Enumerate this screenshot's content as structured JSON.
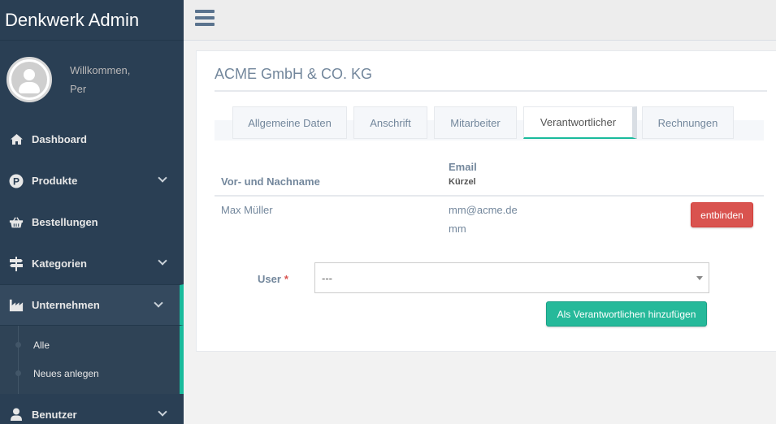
{
  "brand": {
    "title": "Denkwerk Admin"
  },
  "profile": {
    "welcome": "Willkommen,",
    "name": "Per"
  },
  "sidebar": {
    "items": [
      {
        "label": "Dashboard",
        "icon": "home-icon"
      },
      {
        "label": "Produkte",
        "icon": "parking-icon"
      },
      {
        "label": "Bestellungen",
        "icon": "basket-icon"
      },
      {
        "label": "Kategorien",
        "icon": "signpost-icon"
      },
      {
        "label": "Unternehmen",
        "icon": "industry-icon"
      },
      {
        "label": "Benutzer",
        "icon": "user-icon"
      }
    ],
    "submenu": [
      {
        "label": "Alle"
      },
      {
        "label": "Neues anlegen"
      }
    ]
  },
  "panel": {
    "title": "ACME GmbH & CO. KG"
  },
  "tabs": [
    {
      "label": "Allgemeine Daten"
    },
    {
      "label": "Anschrift"
    },
    {
      "label": "Mitarbeiter"
    },
    {
      "label": "Verantwortlicher"
    },
    {
      "label": "Rechnungen"
    }
  ],
  "table": {
    "headers": {
      "name": "Vor- und Nachname",
      "email": "Email",
      "kuerzel": "Kürzel"
    },
    "rows": [
      {
        "name": "Max Müller",
        "email": "mm@acme.de",
        "kuerzel": "mm",
        "action": "entbinden"
      }
    ]
  },
  "form": {
    "user_label": "User",
    "required_mark": "*",
    "select_value": "---",
    "submit_label": "Als Verantwortlichen hinzufügen"
  },
  "colors": {
    "accent": "#1abb9c",
    "sidebar": "#2a3f54",
    "danger": "#d9534f",
    "success": "#26b99a"
  }
}
